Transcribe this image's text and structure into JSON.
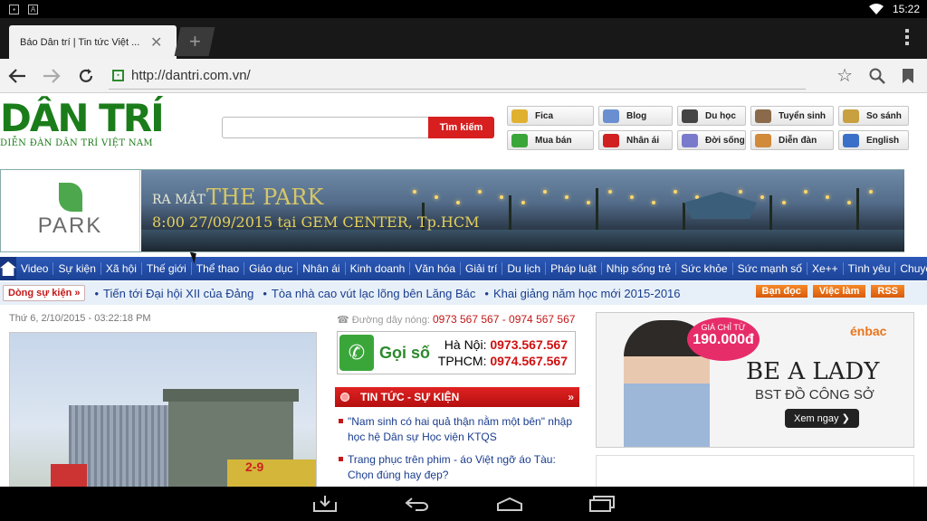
{
  "status_bar": {
    "time": "15:22"
  },
  "browser": {
    "tab_title": "Báo Dân trí | Tin tức Việt ...",
    "url": "http://dantri.com.vn/"
  },
  "site": {
    "logo_text": "DÂN TRÍ",
    "logo_subtitle": "DIỄN ĐÀN DÂN TRÍ VIỆT NAM",
    "search_placeholder": "",
    "search_button": "Tìm kiếm",
    "quick_links": [
      {
        "label": "Fica",
        "color": "#e0b030"
      },
      {
        "label": "Blog",
        "color": "#6a8fd0"
      },
      {
        "label": "Du học",
        "color": "#444444"
      },
      {
        "label": "Tuyển sinh",
        "color": "#8a6a4a"
      },
      {
        "label": "So sánh",
        "color": "#c8a040"
      },
      {
        "label": "Mua bán",
        "color": "#3aa63a"
      },
      {
        "label": "Nhân ái",
        "color": "#d02020"
      },
      {
        "label": "Đời sống",
        "color": "#7a7acc"
      },
      {
        "label": "Diễn đàn",
        "color": "#d08a3a"
      },
      {
        "label": "English",
        "color": "#3a70c8"
      }
    ]
  },
  "banner": {
    "brand": "PARK",
    "launch": "RA MẮT",
    "project": "THE PARK",
    "date_line": "8:00 27/09/2015 tại GEM CENTER, Tp.HCM"
  },
  "categories": [
    "Video",
    "Sự kiện",
    "Xã hội",
    "Thế giới",
    "Thể thao",
    "Giáo dục",
    "Nhân ái",
    "Kinh doanh",
    "Văn hóa",
    "Giải trí",
    "Du lịch",
    "Pháp luật",
    "Nhịp sống trẻ",
    "Sức khỏe",
    "Sức mạnh số",
    "Xe++",
    "Tình yêu",
    "Chuyện lạ"
  ],
  "events": {
    "label": "Dòng sự kiện »",
    "items": [
      "Tiến tới Đại hội XII của Đảng",
      "Tòa nhà cao vút lạc lõng bên Lăng Bác",
      "Khai giảng năm học mới 2015-2016"
    ],
    "buttons": [
      "Bạn đọc",
      "Việc làm",
      "RSS"
    ]
  },
  "main": {
    "datetime": "Thứ 6, 2/10/2015 - 03:22:18 PM",
    "photo_banner": "2-9"
  },
  "hotline": {
    "label": "Đường dây nóng:",
    "numbers": "0973 567 567 - 0974 567 567",
    "goiso": "Gọi số",
    "hanoi_label": "Hà Nội:",
    "hanoi_num": "0973.567.567",
    "hcm_label": "TPHCM:",
    "hcm_num": "0974.567.567"
  },
  "news_section": {
    "title": "TIN TỨC - SỰ KIỆN",
    "items": [
      "\"Nam sinh có hai quả thận nằm một bên\" nhập học hệ Dân sự Học viện KTQS",
      "Trang phục trên phim - áo Việt ngỡ áo Tàu: Chọn đúng hay đẹp?"
    ]
  },
  "ad": {
    "price_top": "GIÁ CHỈ TỪ",
    "price": "190.000đ",
    "brand": "énbac",
    "headline": "BE A LADY",
    "sub": "BST ĐỒ CÔNG SỞ",
    "cta": "Xem ngay ❯"
  }
}
